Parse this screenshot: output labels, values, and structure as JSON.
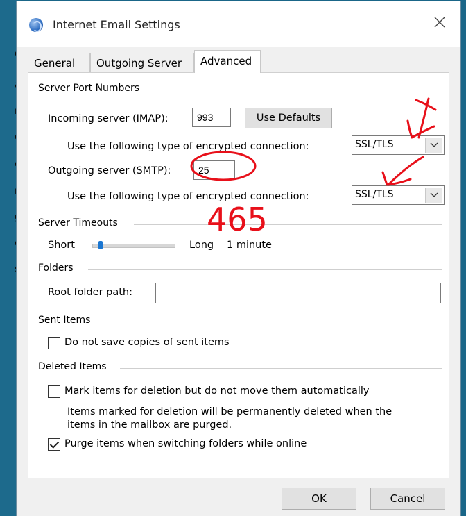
{
  "window": {
    "title": "Internet Email Settings"
  },
  "tabs": [
    {
      "label": "General"
    },
    {
      "label": "Outgoing Server"
    },
    {
      "label": "Advanced"
    }
  ],
  "server_ports": {
    "title": "Server Port Numbers",
    "incoming_label": "Incoming server (IMAP):",
    "incoming_value": "993",
    "use_defaults_label": "Use Defaults",
    "encryption_label": "Use the following type of encrypted connection:",
    "incoming_encryption": "SSL/TLS",
    "outgoing_label": "Outgoing server (SMTP):",
    "outgoing_value": "25",
    "outgoing_encryption": "SSL/TLS"
  },
  "annotation": {
    "handwritten_text": "465",
    "color": "#e8101a"
  },
  "timeouts": {
    "title": "Server Timeouts",
    "short_label": "Short",
    "long_label": "Long",
    "value_label": "1 minute",
    "slider_fraction": 0.1
  },
  "folders": {
    "title": "Folders",
    "root_label": "Root folder path:",
    "root_value": ""
  },
  "sent_items": {
    "title": "Sent Items",
    "do_not_save_label": "Do not save copies of sent items",
    "do_not_save_checked": false
  },
  "deleted_items": {
    "title": "Deleted Items",
    "mark_label": "Mark items for deletion but do not move them automatically",
    "mark_checked": false,
    "note_line1": "Items marked for deletion will be permanently deleted when the",
    "note_line2": "items in the mailbox are purged.",
    "purge_label": "Purge items when switching folders while online",
    "purge_checked": true
  },
  "footer": {
    "ok_label": "OK",
    "cancel_label": "Cancel"
  },
  "background_chars": [
    "e",
    "l",
    "a",
    "n",
    "c",
    "c",
    "r",
    "g",
    "e",
    "s"
  ]
}
